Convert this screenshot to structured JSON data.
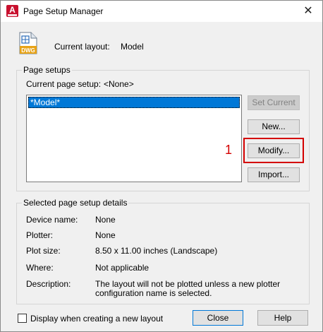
{
  "window": {
    "title": "Page Setup Manager",
    "app_icon_letter": "A",
    "close_glyph": "✕"
  },
  "current_layout": {
    "icon_caption": "DWG",
    "label": "Current layout:",
    "value": "Model"
  },
  "page_setups": {
    "group_title": "Page setups",
    "current_label": "Current page setup:",
    "current_value": "<None>",
    "list_items": [
      "*Model*"
    ],
    "buttons": {
      "set_current": "Set Current",
      "new": "New...",
      "modify": "Modify...",
      "import": "Import..."
    },
    "annotation_number": "1",
    "annotation_color": "#d40000"
  },
  "details": {
    "group_title": "Selected page setup details",
    "rows": [
      {
        "label": "Device name:",
        "value": "None"
      },
      {
        "label": "Plotter:",
        "value": "None"
      },
      {
        "label": "Plot size:",
        "value": "8.50 x 11.00 inches (Landscape)"
      },
      {
        "label": "Where:",
        "value": "Not applicable"
      },
      {
        "label": "Description:",
        "value": "The layout will not be plotted unless a new plotter",
        "value2": "configuration name is selected."
      }
    ]
  },
  "footer": {
    "checkbox_label": "Display when creating a new layout",
    "checkbox_checked": false,
    "close_label": "Close",
    "help_label": "Help"
  },
  "colors": {
    "selection": "#0078d7",
    "app_red": "#c8102e",
    "focus_border": "#0078d7"
  }
}
